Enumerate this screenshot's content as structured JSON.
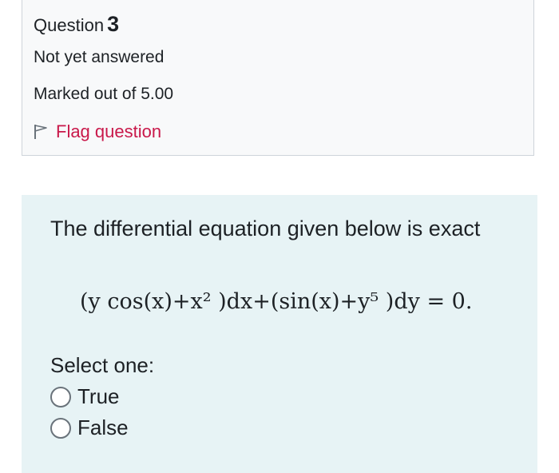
{
  "question_info": {
    "label": "Question",
    "number": "3",
    "state": "Not yet answered",
    "grade": "Marked out of 5.00",
    "flag_label": "Flag question"
  },
  "question": {
    "text": "The differential equation given below is exact",
    "equation": "(y cos(x)+x² )dx+(sin(x)+y⁵ )dy = 0.",
    "select_label": "Select one:",
    "options": [
      {
        "label": "True",
        "selected": false
      },
      {
        "label": "False",
        "selected": false
      }
    ]
  },
  "colors": {
    "info_background": "#f8f9fa",
    "info_border": "#ced4da",
    "formulation_background": "#e7f3f5",
    "flag_color": "#c9184a"
  },
  "icons": {
    "flag": "flag-outline-icon"
  }
}
